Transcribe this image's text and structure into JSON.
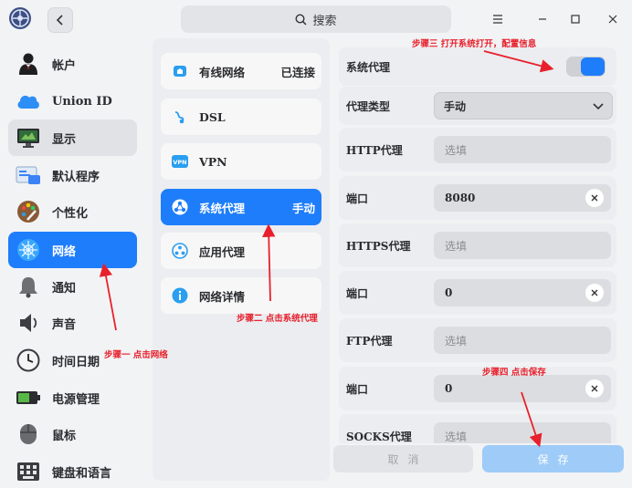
{
  "titlebar": {
    "search_placeholder": "搜索"
  },
  "sidebar": {
    "items": [
      {
        "label": "帐户",
        "icon": "account-icon"
      },
      {
        "label": "Union ID",
        "icon": "cloud-icon"
      },
      {
        "label": "显示",
        "icon": "display-icon"
      },
      {
        "label": "默认程序",
        "icon": "default-apps-icon"
      },
      {
        "label": "个性化",
        "icon": "personalization-icon"
      },
      {
        "label": "网络",
        "icon": "network-icon"
      },
      {
        "label": "通知",
        "icon": "bell-icon"
      },
      {
        "label": "声音",
        "icon": "speaker-icon"
      },
      {
        "label": "时间日期",
        "icon": "clock-icon"
      },
      {
        "label": "电源管理",
        "icon": "battery-icon"
      },
      {
        "label": "鼠标",
        "icon": "mouse-icon"
      },
      {
        "label": "键盘和语言",
        "icon": "keyboard-icon"
      }
    ]
  },
  "network": {
    "items": [
      {
        "label": "有线网络",
        "status": "已连接",
        "icon": "wired-icon"
      },
      {
        "label": "DSL",
        "status": "",
        "icon": "dsl-icon"
      },
      {
        "label": "VPN",
        "status": "",
        "icon": "vpn-icon",
        "icon_text": "VPN"
      },
      {
        "label": "系统代理",
        "status": "手动",
        "icon": "proxy-icon"
      },
      {
        "label": "应用代理",
        "status": "",
        "icon": "app-proxy-icon"
      },
      {
        "label": "网络详情",
        "status": "",
        "icon": "info-icon"
      }
    ]
  },
  "proxy": {
    "system_proxy_label": "系统代理",
    "system_proxy_enabled": true,
    "proxy_type_label": "代理类型",
    "proxy_type_value": "手动",
    "http_label": "HTTP代理",
    "http_placeholder": "选填",
    "http_port_label": "端口",
    "http_port_value": "8080",
    "https_label": "HTTPS代理",
    "https_placeholder": "选填",
    "https_port_label": "端口",
    "https_port_value": "0",
    "ftp_label": "FTP代理",
    "ftp_placeholder": "选填",
    "ftp_port_label": "端口",
    "ftp_port_value": "0",
    "socks_label": "SOCKS代理",
    "socks_placeholder": "选填"
  },
  "buttons": {
    "cancel": "取消",
    "save": "保存"
  },
  "annotations": {
    "step1": "步骤一 点击网络",
    "step2": "步骤二 点击系统代理",
    "step3": "步骤三 打开系统打开，配置信息",
    "step4": "步骤四 点击保存"
  },
  "colors": {
    "accent": "#1e7dfa",
    "annotation": "#e8202b"
  }
}
